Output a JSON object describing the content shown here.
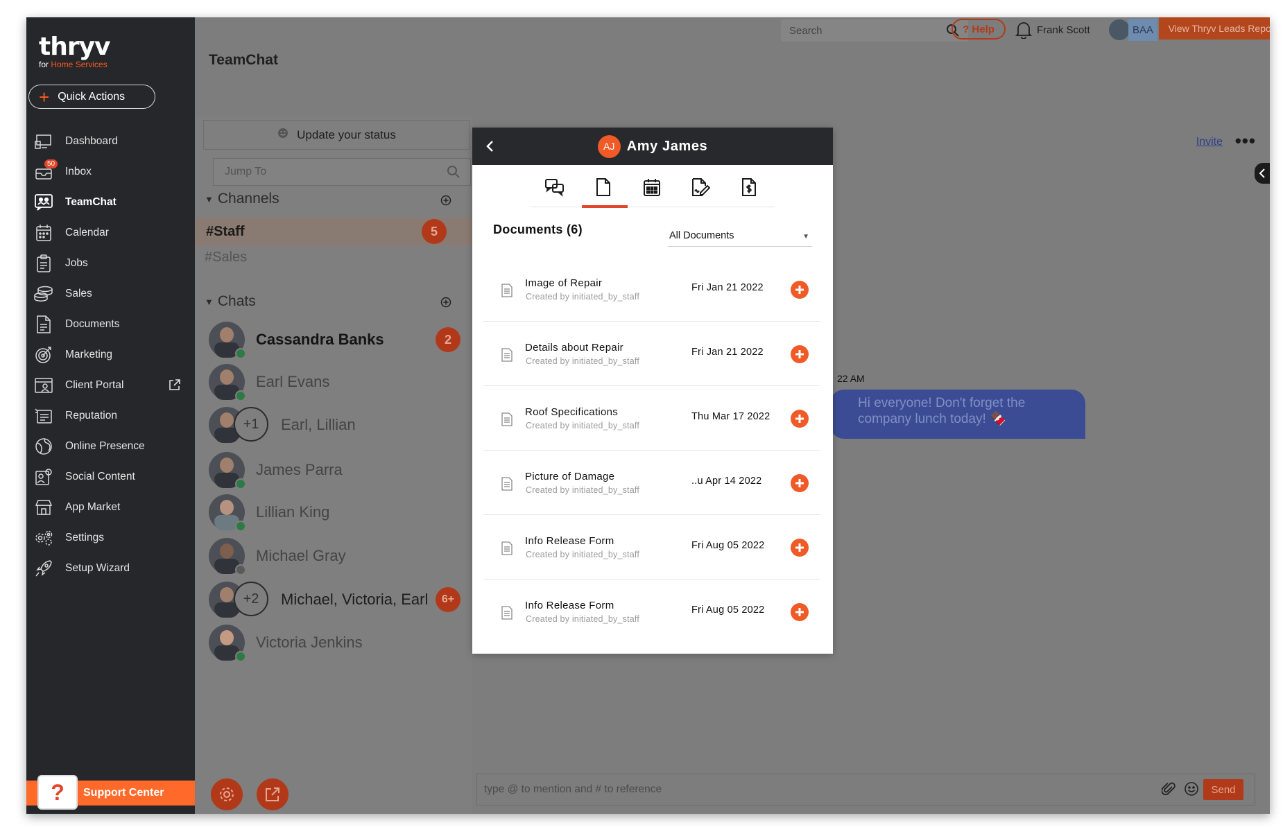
{
  "brand": {
    "name": "thryv",
    "sub_prefix": "for ",
    "sub_highlight": "Home Services"
  },
  "quick_actions": "Quick Actions",
  "nav": [
    {
      "label": "Dashboard"
    },
    {
      "label": "Inbox",
      "badge": "50"
    },
    {
      "label": "TeamChat",
      "active": true
    },
    {
      "label": "Calendar"
    },
    {
      "label": "Jobs"
    },
    {
      "label": "Sales"
    },
    {
      "label": "Documents"
    },
    {
      "label": "Marketing"
    },
    {
      "label": "Client Portal"
    },
    {
      "label": "Reputation"
    },
    {
      "label": "Online Presence"
    },
    {
      "label": "Social Content"
    },
    {
      "label": "App Market"
    },
    {
      "label": "Settings"
    },
    {
      "label": "Setup Wizard"
    }
  ],
  "support": "Support Center",
  "support_icon": "?",
  "page_title": "TeamChat",
  "header": {
    "search_placeholder": "Search",
    "help": "? Help",
    "username": "Frank Scott",
    "org": "BAA",
    "leads_button": "View Thryv Leads Report"
  },
  "panel": {
    "status": "Update your status",
    "jump_placeholder": "Jump To",
    "channels_title": "Channels",
    "channels": [
      {
        "name": "#Staff",
        "count": "5"
      },
      {
        "name": "#Sales"
      }
    ],
    "chats_title": "Chats",
    "chats": [
      {
        "name": "Cassandra Banks",
        "count": "2"
      },
      {
        "name": "Earl Evans"
      },
      {
        "name": "Earl, Lillian",
        "plus": "+1"
      },
      {
        "name": "James Parra"
      },
      {
        "name": "Lillian King"
      },
      {
        "name": "Michael Gray"
      },
      {
        "name": "Michael, Victoria, Earl",
        "plus": "+2",
        "count": "6+"
      },
      {
        "name": "Victoria Jenkins"
      }
    ]
  },
  "chat": {
    "invite": "Invite",
    "more": "•••",
    "msg_time": "22 AM",
    "message": "Hi everyone! Don't forget the company lunch today! 🍫",
    "composer_placeholder": "type @ to mention and # to reference",
    "send": "Send"
  },
  "modal": {
    "initials": "AJ",
    "name": "Amy James",
    "documents_title": "Documents (6)",
    "filter": "All Documents",
    "documents": [
      {
        "name": "Image of Repair",
        "by": "Created by initiated_by_staff",
        "date": "Fri Jan 21 2022"
      },
      {
        "name": "Details about Repair",
        "by": "Created by initiated_by_staff",
        "date": "Fri Jan 21 2022"
      },
      {
        "name": "Roof Specifications",
        "by": "Created by initiated_by_staff",
        "date": "Thu Mar 17 2022"
      },
      {
        "name": "Picture of Damage",
        "by": "Created by initiated_by_staff",
        "date": "..u Apr 14 2022"
      },
      {
        "name": "Info Release Form",
        "by": "Created by initiated_by_staff",
        "date": "Fri Aug 05 2022"
      },
      {
        "name": "Info Release Form",
        "by": "Created by initiated_by_staff",
        "date": "Fri Aug 05 2022"
      }
    ]
  },
  "colors": {
    "accent": "#ef5a27",
    "sidebar": "#25272b",
    "bubble": "#3b4b94"
  }
}
